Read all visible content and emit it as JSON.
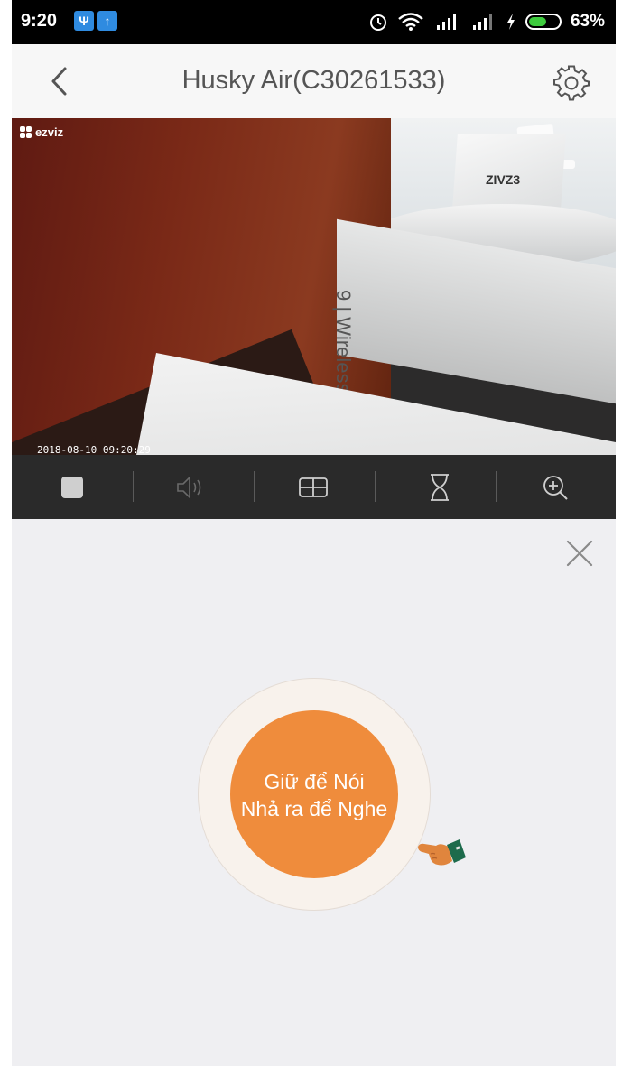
{
  "status_bar": {
    "time": "9:20",
    "battery_percent": "63%",
    "battery_level": 0.63,
    "icons": [
      "usb-icon",
      "upload-icon",
      "alarm-icon",
      "wifi-icon",
      "signal-icon",
      "signal-icon",
      "charging-icon",
      "battery-icon"
    ]
  },
  "header": {
    "title": "Husky Air(C30261533)",
    "back_icon": "chevron-left-icon",
    "settings_icon": "gear-icon"
  },
  "video": {
    "logo_text": "ezviz",
    "box_text": "ZIVZ3",
    "product_text": "9 | Wireless Siren",
    "timestamp": "2018-08-10 09:20:29"
  },
  "toolbar": {
    "items": [
      "stop-icon",
      "speaker-icon",
      "grid-icon",
      "hourglass-icon",
      "zoom-in-icon"
    ]
  },
  "talk": {
    "line1": "Giữ để Nói",
    "line2": "Nhả ra để Nghe",
    "close_icon": "close-icon",
    "hint_icon": "pointing-hand-icon"
  },
  "colors": {
    "accent": "#ef8c3c",
    "talk_ring": "#f8f2ec",
    "toolbar_bg": "#2a2a2a",
    "panel_bg": "#efeff2"
  }
}
